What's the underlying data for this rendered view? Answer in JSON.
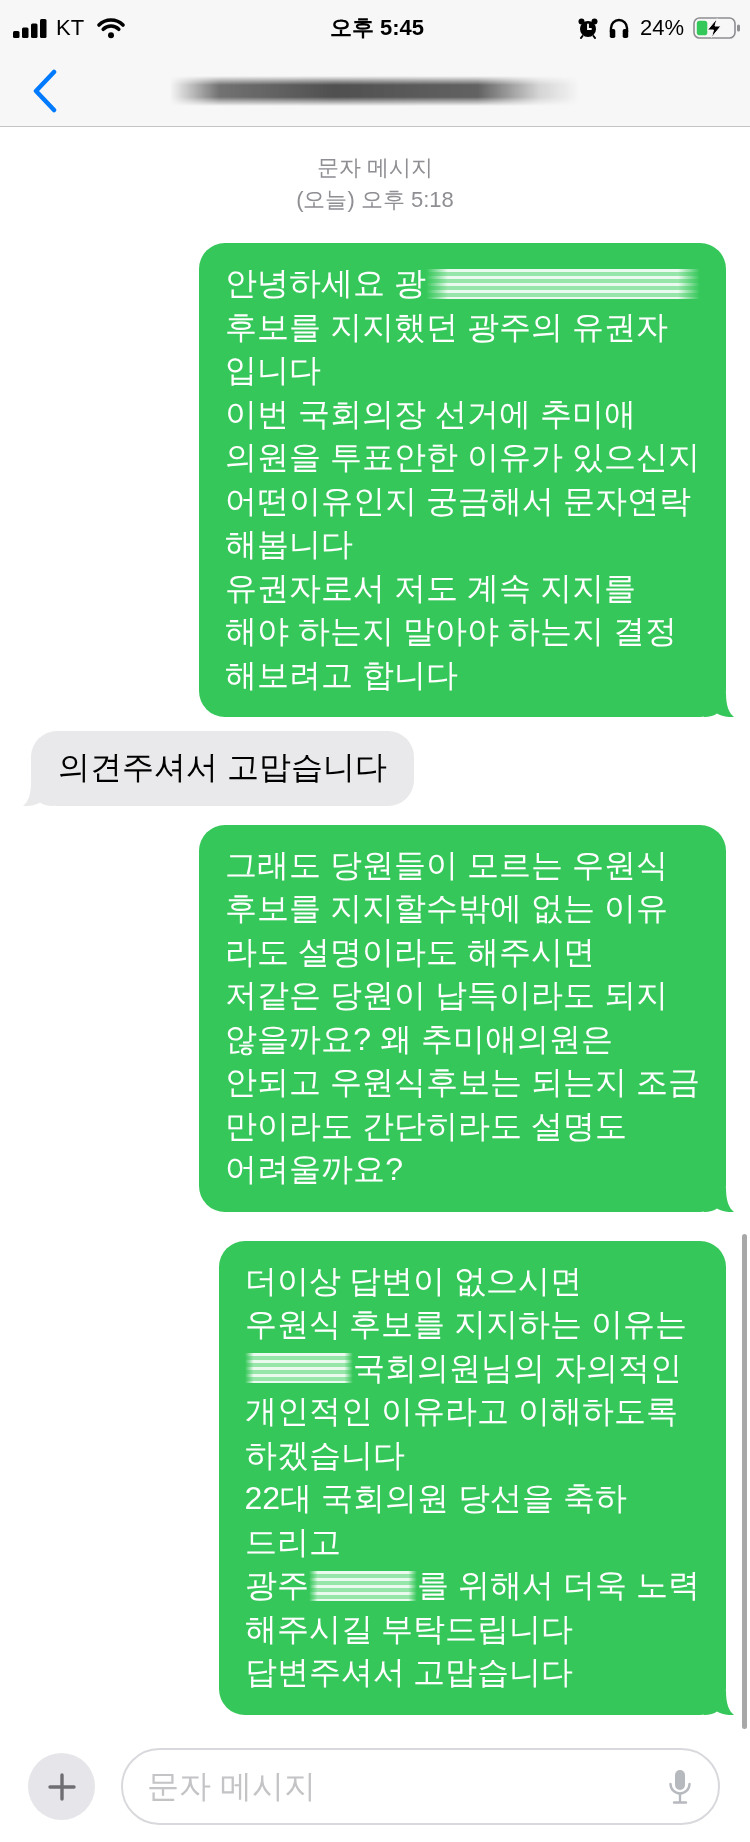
{
  "status_bar": {
    "carrier": "KT",
    "time": "오후 5:45",
    "battery": "24%"
  },
  "thread": {
    "service": "문자 메시지",
    "timestamp": "(오늘) 오후 5:18"
  },
  "messages": [
    {
      "kind": "sent",
      "lines": [
        [
          {
            "kind": "text",
            "text": "안녕하세요 광"
          },
          {
            "kind": "redacted"
          }
        ],
        [
          {
            "kind": "text",
            "text": "후보를 지지했던 광주의 유권자"
          }
        ],
        [
          {
            "kind": "text",
            "text": "입니다"
          }
        ],
        [
          {
            "kind": "text",
            "text": "이번 국회의장 선거에 추미애"
          }
        ],
        [
          {
            "kind": "text",
            "text": "의원을 투표안한 이유가 있으신지"
          }
        ],
        [
          {
            "kind": "text",
            "text": "어떤이유인지 궁금해서 문자연락"
          }
        ],
        [
          {
            "kind": "text",
            "text": "해봅니다"
          }
        ],
        [
          {
            "kind": "text",
            "text": "유권자로서 저도 계속 지지를"
          }
        ],
        [
          {
            "kind": "text",
            "text": "해야 하는지 말아야 하는지 결정"
          }
        ],
        [
          {
            "kind": "text",
            "text": "해보려고 합니다"
          }
        ]
      ]
    },
    {
      "kind": "received",
      "lines": [
        [
          {
            "kind": "text",
            "text": "의견주셔서 고맙습니다"
          }
        ]
      ]
    },
    {
      "kind": "sent",
      "lines": [
        [
          {
            "kind": "text",
            "text": "그래도 당원들이 모르는 우원식"
          }
        ],
        [
          {
            "kind": "text",
            "text": "후보를 지지할수밖에 없는 이유"
          }
        ],
        [
          {
            "kind": "text",
            "text": "라도 설명이라도 해주시면"
          }
        ],
        [
          {
            "kind": "text",
            "text": "저같은 당원이 납득이라도 되지"
          }
        ],
        [
          {
            "kind": "text",
            "text": "않을까요? 왜 추미애의원은"
          }
        ],
        [
          {
            "kind": "text",
            "text": "안되고 우원식후보는 되는지 조금"
          }
        ],
        [
          {
            "kind": "text",
            "text": "만이라도 간단히라도 설명도"
          }
        ],
        [
          {
            "kind": "text",
            "text": "어려울까요?"
          }
        ]
      ]
    },
    {
      "kind": "sent",
      "lines": [
        [
          {
            "kind": "text",
            "text": "더이상 답변이 없으시면"
          }
        ],
        [
          {
            "kind": "text",
            "text": "우원식 후보를 지지하는 이유는"
          }
        ],
        [
          {
            "kind": "redacted"
          },
          {
            "kind": "text",
            "text": "국회의원님의 자의적인"
          }
        ],
        [
          {
            "kind": "text",
            "text": "개인적인 이유라고 이해하도록"
          }
        ],
        [
          {
            "kind": "text",
            "text": "하겠습니다"
          }
        ],
        [
          {
            "kind": "text",
            "text": "22대 국회의원 당선을 축하"
          }
        ],
        [
          {
            "kind": "text",
            "text": "드리고"
          }
        ],
        [
          {
            "kind": "text",
            "text": "광주"
          },
          {
            "kind": "redacted"
          },
          {
            "kind": "text",
            "text": "를 위해서 더욱 노력"
          }
        ],
        [
          {
            "kind": "text",
            "text": "해주시길 부탁드립니다"
          }
        ],
        [
          {
            "kind": "text",
            "text": "답변주셔서 고맙습니다"
          }
        ]
      ]
    }
  ],
  "composer": {
    "placeholder": "문자 메시지"
  }
}
